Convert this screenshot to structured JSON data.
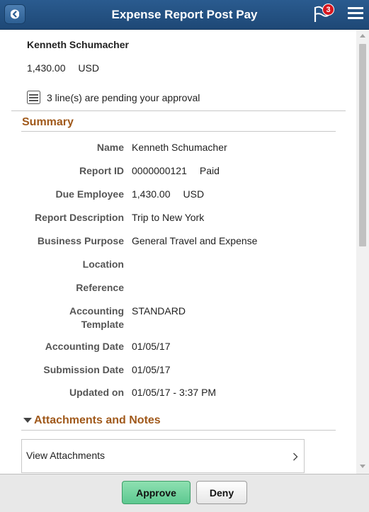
{
  "header": {
    "title": "Expense Report Post Pay",
    "notification_count": "3",
    "back_icon": "chevron-left-icon",
    "flag_icon": "flag-icon",
    "menu_icon": "hamburger-menu-icon",
    "bar_color": "#24507f"
  },
  "report": {
    "employee_name": "Kenneth Schumacher",
    "amount": "1,430.00",
    "currency": "USD",
    "pending_text": "3 line(s) are pending your approval"
  },
  "summary": {
    "title": "Summary",
    "rows": [
      {
        "label": "Name",
        "value": "Kenneth Schumacher",
        "extra": ""
      },
      {
        "label": "Report ID",
        "value": "0000000121",
        "extra": "Paid"
      },
      {
        "label": "Due Employee",
        "value": "1,430.00",
        "extra": "USD"
      },
      {
        "label": "Report Description",
        "value": "Trip to New York",
        "extra": ""
      },
      {
        "label": "Business Purpose",
        "value": "General Travel and Expense",
        "extra": ""
      },
      {
        "label": "Location",
        "value": "",
        "extra": ""
      },
      {
        "label": "Reference",
        "value": "",
        "extra": ""
      },
      {
        "label": "Accounting",
        "label2": "Template",
        "value": "STANDARD",
        "extra": ""
      },
      {
        "label": "Accounting Date",
        "value": "01/05/17",
        "extra": ""
      },
      {
        "label": "Submission Date",
        "value": "01/05/17",
        "extra": ""
      },
      {
        "label": "Updated on",
        "value": "01/05/17 - 3:37 PM",
        "extra": ""
      }
    ]
  },
  "attachments": {
    "title": "Attachments and Notes",
    "view_label": "View Attachments"
  },
  "footer": {
    "approve_label": "Approve",
    "deny_label": "Deny"
  },
  "colors": {
    "section_title": "#a0591b",
    "approve_button": "#6fd39c"
  }
}
